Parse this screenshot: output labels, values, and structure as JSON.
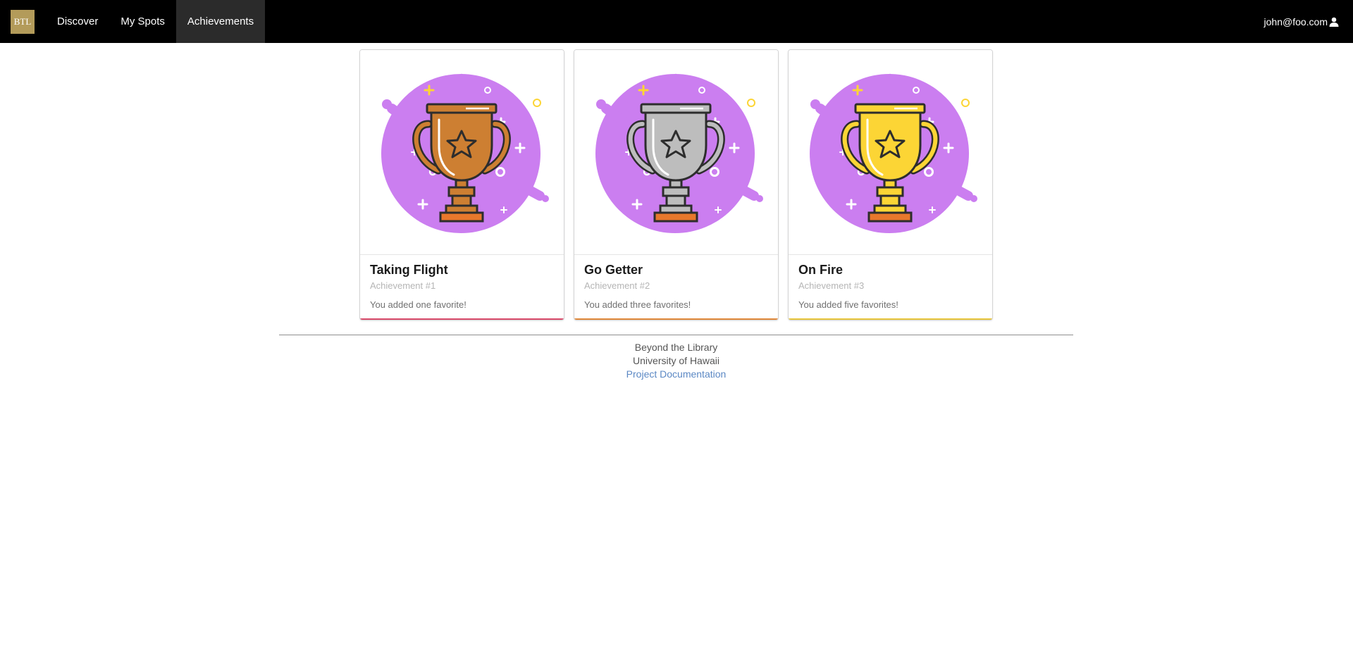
{
  "nav": {
    "brand": "BTL",
    "items": [
      {
        "label": "Discover",
        "active": false
      },
      {
        "label": "My Spots",
        "active": false
      },
      {
        "label": "Achievements",
        "active": true
      }
    ],
    "user": "john@foo.com"
  },
  "achievements": [
    {
      "title": "Taking Flight",
      "number": "Achievement #1",
      "description": "You added one favorite!",
      "cup_color": "#cd7f32",
      "accent": "#d94a6a"
    },
    {
      "title": "Go Getter",
      "number": "Achievement #2",
      "description": "You added three favorites!",
      "cup_color": "#bdbdbd",
      "accent": "#e0883a"
    },
    {
      "title": "On Fire",
      "number": "Achievement #3",
      "description": "You added five favorites!",
      "cup_color": "#fcd535",
      "accent": "#e8c53a"
    }
  ],
  "footer": {
    "line1": "Beyond the Library",
    "line2": "University of Hawaii",
    "link": "Project Documentation"
  },
  "colors": {
    "navbar_bg": "#000000",
    "brand_bg": "#b39b5a",
    "badge_circle": "#cb7ef0"
  }
}
